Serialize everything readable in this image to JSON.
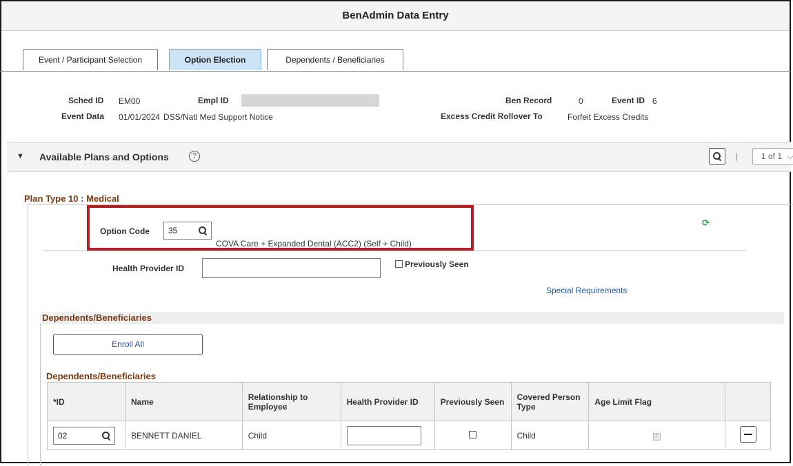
{
  "window": {
    "title": "BenAdmin Data Entry"
  },
  "tabs": [
    {
      "label": "Event / Participant Selection",
      "active": false
    },
    {
      "label": "Option Election",
      "active": true
    },
    {
      "label": "Dependents / Beneficiaries",
      "active": false
    }
  ],
  "header": {
    "sched_id_label": "Sched ID",
    "sched_id_value": "EM00",
    "empl_id_label": "Empl ID",
    "ben_record_label": "Ben Record",
    "ben_record_value": "0",
    "event_id_label": "Event ID",
    "event_id_value": "6",
    "event_data_label": "Event Data",
    "event_date": "01/01/2024",
    "event_reason": "DSS/Natl Med Support Notice",
    "excess_credit_label": "Excess Credit Rollover To",
    "excess_credit_value": "Forfeit Excess Credits"
  },
  "section": {
    "title": "Available Plans and Options",
    "help": "?",
    "pager": "1 of 1"
  },
  "plan": {
    "plan_type": "Plan Type 10 : Medical",
    "option_code_label": "Option Code",
    "option_code_value": "35",
    "option_description": "COVA Care + Expanded Dental (ACC2) (Self + Child)",
    "health_provider_label": "Health Provider ID",
    "health_provider_value": "",
    "previously_seen_label": "Previously Seen",
    "special_requirements_link": "Special Requirements",
    "refresh_glyph": "⟳"
  },
  "dependents": {
    "section_title": "Dependents/Beneficiaries",
    "enroll_all": "Enroll All",
    "grid_title": "Dependents/Beneficiaries",
    "columns": {
      "id": "*ID",
      "name": "Name",
      "relationship": "Relationship to Employee",
      "health_provider": "Health Provider ID",
      "previously_seen": "Previously Seen",
      "covered_type": "Covered Person Type",
      "age_limit": "Age Limit Flag"
    },
    "rows": [
      {
        "id": "02",
        "name": "BENNETT DANIEL",
        "relationship": "Child",
        "health_provider": "",
        "covered_type": "Child"
      }
    ]
  },
  "colors": {
    "accent": "#1f5aa6",
    "highlight_box": "#b21f24",
    "heading_brown": "#7a3a10",
    "active_tab": "#cde4f7"
  }
}
